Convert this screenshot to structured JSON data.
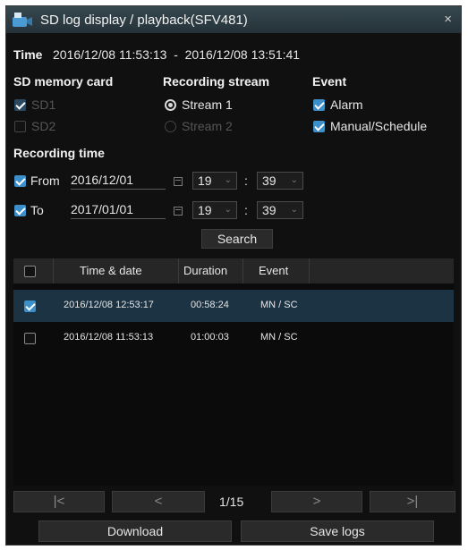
{
  "window": {
    "title": "SD log display / playback(SFV481)",
    "close": "×"
  },
  "time": {
    "label": "Time",
    "value": "2016/12/08 11:53:13  -  2016/12/08 13:51:41"
  },
  "sd_card": {
    "heading": "SD memory card",
    "sd1": {
      "label": "SD1",
      "checked": true,
      "enabled": false
    },
    "sd2": {
      "label": "SD2",
      "checked": false,
      "enabled": false
    }
  },
  "stream": {
    "heading": "Recording stream",
    "s1": {
      "label": "Stream 1",
      "selected": true
    },
    "s2": {
      "label": "Stream 2",
      "selected": false
    }
  },
  "event": {
    "heading": "Event",
    "alarm": {
      "label": "Alarm",
      "checked": true
    },
    "manual": {
      "label": "Manual/Schedule",
      "checked": true
    }
  },
  "rec_time": {
    "heading": "Recording time",
    "from": {
      "label": "From",
      "date": "2016/12/01",
      "hour": "19",
      "minute": "39"
    },
    "to": {
      "label": "To",
      "date": "2017/01/01",
      "hour": "19",
      "minute": "39"
    },
    "colon": ":"
  },
  "search_button": "Search",
  "table": {
    "headers": [
      "Time & date",
      "Duration",
      "Event"
    ],
    "rows": [
      {
        "datetime": "2016/12/08 12:53:17",
        "duration": "00:58:24",
        "event": "MN / SC",
        "checked": true,
        "selected": true
      },
      {
        "datetime": "2016/12/08 11:53:13",
        "duration": "01:00:03",
        "event": "MN / SC",
        "checked": false,
        "selected": false
      }
    ]
  },
  "pager": {
    "first": "|<",
    "prev": "<",
    "page": "1/15",
    "next": ">",
    "last": ">|"
  },
  "actions": {
    "download": "Download",
    "save_logs": "Save logs"
  },
  "colors": {
    "accent": "#3c8fc9",
    "background": "#101010",
    "selected_row": "#1c3344"
  }
}
